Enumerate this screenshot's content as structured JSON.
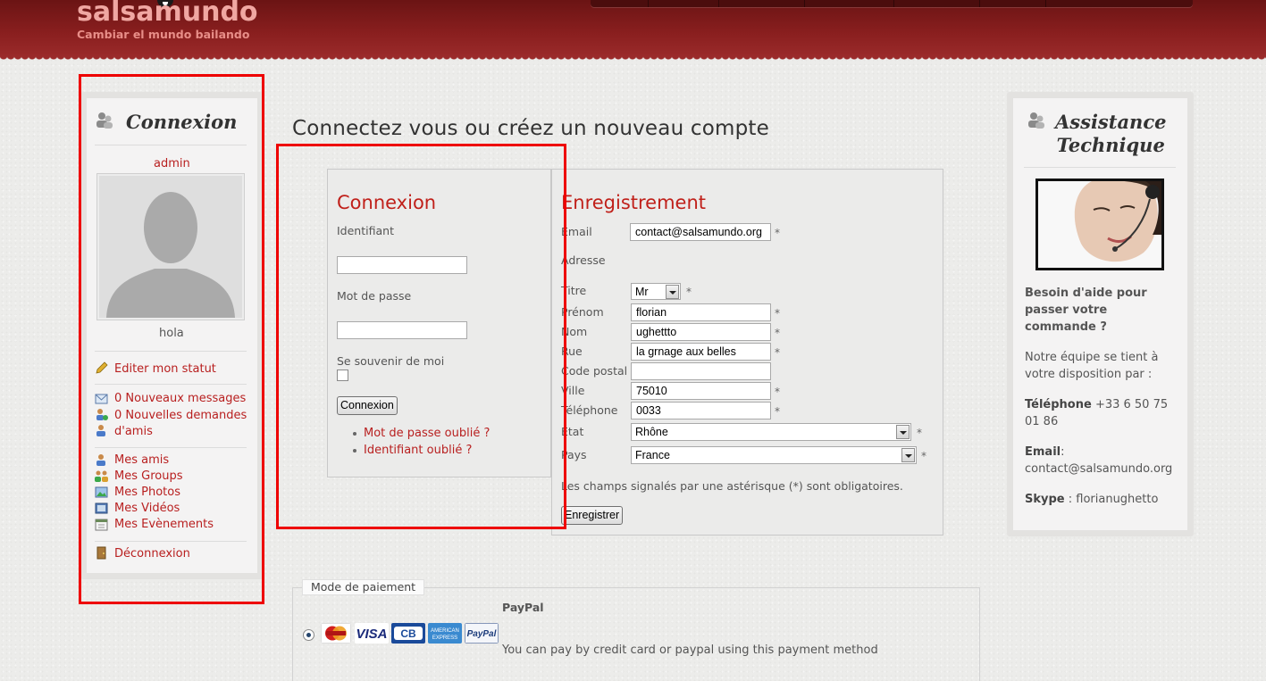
{
  "brand": {
    "name": "salsamundo",
    "tagline": "Cambiar el mundo bailando"
  },
  "left_panel": {
    "title": "Connexion",
    "username": "admin",
    "status": "hola",
    "edit_status": "Editer mon statut",
    "messages": "0 Nouveaux messages",
    "friend_requests_line1": "0 Nouvelles demandes",
    "friend_requests_line2": "d'amis",
    "friends": "Mes amis",
    "groups": "Mes Groups",
    "photos": "Mes Photos",
    "videos": "Mes Vidéos",
    "events": "Mes Evènements",
    "logout": "Déconnexion"
  },
  "main": {
    "heading": "Connectez vous ou créez un nouveau compte"
  },
  "login": {
    "title": "Connexion",
    "username_label": "Identifiant",
    "username_value": "",
    "password_label": "Mot de passe",
    "password_value": "",
    "remember_label": "Se souvenir de moi",
    "submit": "Connexion",
    "forgot_password": "Mot de passe oublié ?",
    "forgot_username": "Identifiant oublié ?"
  },
  "register": {
    "title": "Enregistrement",
    "email_label": "Email",
    "email_value": "contact@salsamundo.org",
    "address_label": "Adresse",
    "title_label": "Titre",
    "title_value": "Mr",
    "firstname_label": "Prénom",
    "firstname_value": "florian",
    "lastname_label": "Nom",
    "lastname_value": "ughettto",
    "street_label": "Rue",
    "street_value": "la grnage aux belles",
    "zip_label": "Code postal",
    "zip_value": "",
    "city_label": "Ville",
    "city_value": "75010",
    "phone_label": "Téléphone",
    "phone_value": "0033",
    "state_label": "Etat",
    "state_value": "Rhône",
    "country_label": "Pays",
    "country_value": "France",
    "required_marker": "*",
    "required_note": "Les champs signalés par une astérisque (*) sont obligatoires.",
    "submit": "Enregistrer"
  },
  "support": {
    "title_line1": "Assistance",
    "title_line2": "Technique",
    "help_line1": "Besoin d'aide pour",
    "help_line2": "passer votre",
    "help_line3": "commande ?",
    "team_line1": "Notre équipe se tient à",
    "team_line2": "votre disposition par :",
    "phone_label": "Téléphone",
    "phone_value_line1": "+33 6 50 75",
    "phone_value_line2": "01 86",
    "email_label": "Email",
    "email_colon": ":",
    "email_value": "contact@salsamundo.org",
    "skype_label": "Skype",
    "skype_value": ": florianughetto"
  },
  "payment": {
    "legend": "Mode de paiement",
    "method_name": "PayPal",
    "method_description": "You can pay by credit card or paypal using this payment method",
    "cards": [
      "MasterCard",
      "VISA",
      "CB",
      "AMERICAN EXPRESS",
      "PayPal"
    ]
  },
  "colors": {
    "brand_red": "#b81f1f",
    "header_dark": "#6b1414",
    "highlight": "#ee0000"
  }
}
